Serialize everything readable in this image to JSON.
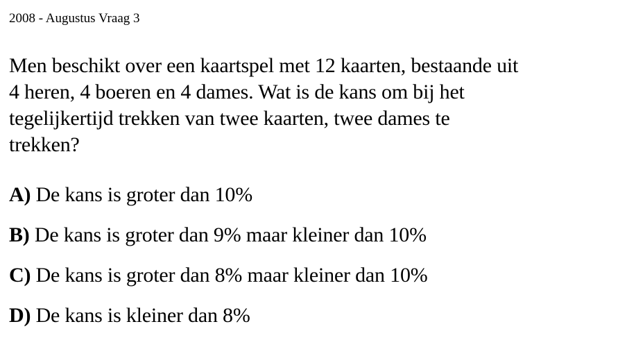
{
  "header": {
    "title": "2008 - Augustus Vraag 3"
  },
  "question": {
    "lines": [
      "Men beschikt over een kaartspel met 12 kaarten, bestaande uit",
      "4 heren, 4 boeren en 4 dames. Wat is de kans om bij het",
      "tegelijkertijd trekken van twee kaarten, twee dames te",
      "trekken?"
    ]
  },
  "options": [
    {
      "letter": "A)",
      "text": " De kans is groter dan 10%"
    },
    {
      "letter": "B)",
      "text": " De kans is groter dan 9% maar kleiner dan 10%"
    },
    {
      "letter": "C)",
      "text": " De kans is groter dan 8% maar kleiner dan 10%"
    },
    {
      "letter": "D)",
      "text": " De kans is kleiner dan 8%"
    }
  ]
}
